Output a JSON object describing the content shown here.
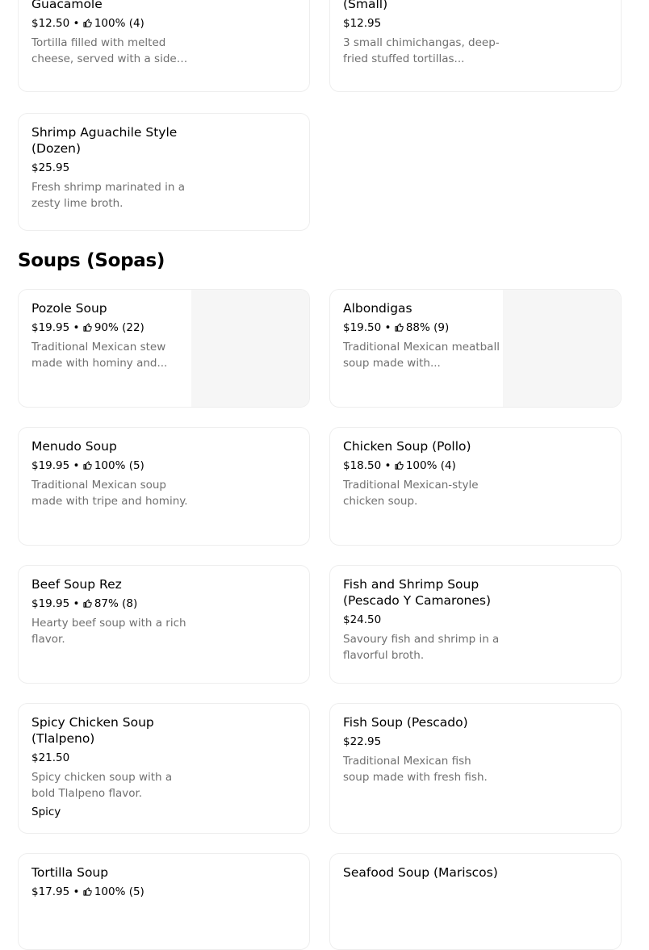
{
  "section": {
    "title": "Soups (Sopas)"
  },
  "items": {
    "guacamole": {
      "name": "Guacamole",
      "price": "$12.50",
      "rating": "100% (4)",
      "description": "Tortilla filled with melted cheese, served with a side ..."
    },
    "chimichangas": {
      "name": "(Small)",
      "price": "$12.95",
      "description": "3 small chimichangas, deep-fried stuffed tortillas..."
    },
    "shrimp_aguachile": {
      "name": "Shrimp Aguachile Style (Dozen)",
      "price": "$25.95",
      "description": "Fresh shrimp marinated in a zesty lime broth."
    },
    "pozole": {
      "name": "Pozole Soup",
      "price": "$19.95",
      "rating": "90% (22)",
      "description": "Traditional Mexican stew made with hominy and..."
    },
    "albondigas": {
      "name": "Albondigas",
      "price": "$19.50",
      "rating": "88% (9)",
      "description": "Traditional Mexican meatball soup made with..."
    },
    "menudo": {
      "name": "Menudo Soup",
      "price": "$19.95",
      "rating": "100% (5)",
      "description": "Traditional Mexican soup made with tripe and hominy."
    },
    "chicken_soup": {
      "name": "Chicken Soup (Pollo)",
      "price": "$18.50",
      "rating": "100% (4)",
      "description": "Traditional Mexican-style chicken soup."
    },
    "beef_soup": {
      "name": "Beef Soup Rez",
      "price": "$19.95",
      "rating": "87% (8)",
      "description": "Hearty beef soup with a rich flavor."
    },
    "fish_shrimp_soup": {
      "name": "Fish and Shrimp Soup (Pescado Y Camarones)",
      "price": "$24.50",
      "description": "Savoury fish and shrimp in a flavorful broth."
    },
    "spicy_chicken_soup": {
      "name": "Spicy Chicken Soup (Tlalpeno)",
      "price": "$21.50",
      "description": "Spicy chicken soup with a bold Tlalpeno flavor.",
      "tag": "Spicy"
    },
    "fish_soup": {
      "name": "Fish Soup (Pescado)",
      "price": "$22.95",
      "description": "Traditional Mexican fish soup made with fresh fish."
    },
    "tortilla_soup": {
      "name": "Tortilla Soup",
      "price": "$17.95",
      "rating": "100% (5)"
    },
    "seafood_soup": {
      "name": "Seafood Soup (Mariscos)"
    }
  },
  "meta": {
    "separator": "•"
  },
  "icons": {
    "rating": "thumbs-up-icon"
  },
  "colors": {
    "description": "#707070",
    "card_border": "#eeeeee",
    "thumbnail": "#f6f6f6"
  }
}
